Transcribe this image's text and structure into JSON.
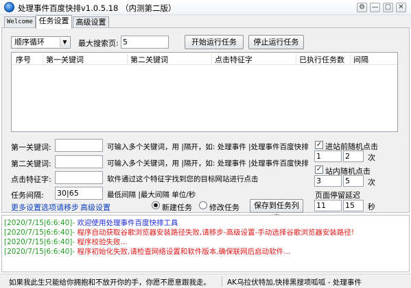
{
  "window": {
    "title": "处理事件百度快排v1.0.5.18 （内测第二版）",
    "controls": {
      "settings": "⚙",
      "minimize": "—",
      "maximize": "▢",
      "close": "✕"
    }
  },
  "tabs": [
    {
      "label": "Welcome"
    },
    {
      "label": "任务设置"
    },
    {
      "label": "高级设置"
    }
  ],
  "top_controls": {
    "mode_value": "顺序循环",
    "max_page_label": "最大搜索页:",
    "max_page_value": "5",
    "start_button": "开始运行任务",
    "stop_button": "停止运行任务"
  },
  "table": {
    "columns": [
      "序号",
      "第一关键词",
      "第二关键词",
      "点击特征字",
      "已执行任务数",
      "间隔"
    ],
    "rows": []
  },
  "form": {
    "kw1_label": "第一关键词:",
    "kw1_value": "",
    "kw1_hint": "可输入多个关键词，用 |隔开，如: 处理事件 |处理事件百度快排",
    "kw2_label": "第二关键词:",
    "kw2_value": "",
    "kw2_hint": "可输入多个关键词，用 |隔开，如: 处理事件 |处理事件百度快排",
    "feature_label": "点击特征字:",
    "feature_value": "",
    "feature_hint": "软件通过这个特征字找到您的目标网站进行点击",
    "interval_label": "任务间隔:",
    "interval_value": "30|65",
    "interval_hint": "最低间隔 |最大间隔  单位/秒",
    "more_settings_link": "更多设置选项请移步",
    "advanced_link": "高级设置",
    "radio_new": "新建任务",
    "radio_edit": "修改任务",
    "save_button": "保存到任务列表"
  },
  "side_options": {
    "pre_click_label": "进站前随机点击",
    "pre_click_checked": true,
    "pre_min": "1",
    "pre_max": "2",
    "pre_unit": "次",
    "in_click_label": "站内随机点击",
    "in_click_checked": true,
    "in_min": "3",
    "in_max": "5",
    "in_unit": "次",
    "delay_label": "页面停留延迟",
    "delay_min": "11",
    "delay_max": "15",
    "delay_unit": "秒",
    "range_sep": "—"
  },
  "log": [
    {
      "time": "[2020/7/15|6:6:40]-",
      "text": "欢迎使用处理事件百度快排工具",
      "color": "#1b2bd6"
    },
    {
      "time": "[2020/7/15|6:6:40]-",
      "text": "程序自动获取谷歌浏览器安装路径失败,请移步-高级设置-手动选择谷歌浏览器安装路径!",
      "color": "#e01818"
    },
    {
      "time": "[2020/7/15|6:6:40]-",
      "text": "程序校验失败...",
      "color": "#e01818"
    },
    {
      "time": "[2020/7/15|6:6:40]-",
      "text": "程序初始化失败,请检查网络设置和软件版本,确保联网后启动软件...",
      "color": "#e01818"
    }
  ],
  "statusbar": {
    "left": "如果我此生只能给你拥抱和不放开你的手，你愿不愿意跟我走。",
    "right": "AK乌拉伏特加,快排黑搜项呱呱  -  处理事件"
  }
}
